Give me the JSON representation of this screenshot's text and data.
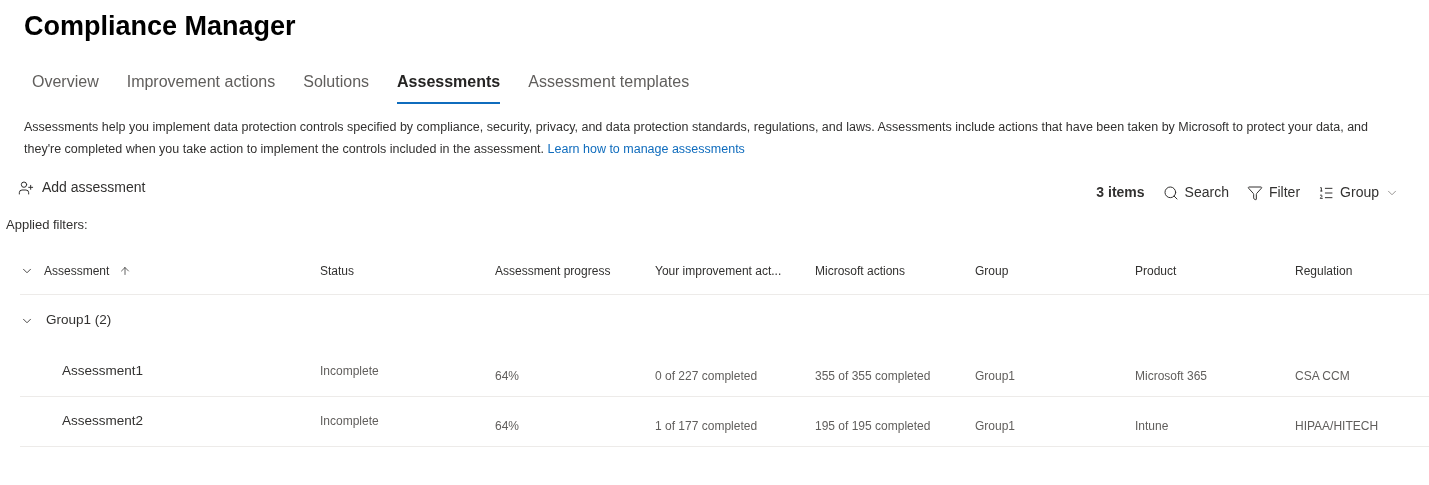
{
  "page_title": "Compliance Manager",
  "tabs": [
    {
      "label": "Overview",
      "selected": false
    },
    {
      "label": "Improvement actions",
      "selected": false
    },
    {
      "label": "Solutions",
      "selected": false
    },
    {
      "label": "Assessments",
      "selected": true
    },
    {
      "label": "Assessment templates",
      "selected": false
    }
  ],
  "description": {
    "text": "Assessments help you implement data protection controls specified by compliance, security, privacy, and data protection standards, regulations, and laws. Assessments include actions that have been taken by Microsoft to protect your data, and they're completed when you take action to implement the controls included in the assessment.",
    "link": "Learn how to manage assessments"
  },
  "add_button": "Add assessment",
  "toolbar": {
    "count": "3 items",
    "search": "Search",
    "filter": "Filter",
    "group": "Group"
  },
  "applied_filters": "Applied filters:",
  "table": {
    "columns": [
      "Assessment",
      "Status",
      "Assessment progress",
      "Your improvement act...",
      "Microsoft actions",
      "Group",
      "Product",
      "Regulation"
    ],
    "groups": [
      {
        "label": "Group1 (2)",
        "expanded": true,
        "rows": [
          [
            "Assessment1",
            "Incomplete",
            "64%",
            "0 of 227 completed",
            "355 of 355 completed",
            "Group1",
            "Microsoft 365",
            "CSA CCM"
          ],
          [
            "Assessment2",
            "Incomplete",
            "64%",
            "1 of 177 completed",
            "195 of 195 completed",
            "Group1",
            "Intune",
            "HIPAA/HITECH"
          ]
        ]
      }
    ]
  }
}
